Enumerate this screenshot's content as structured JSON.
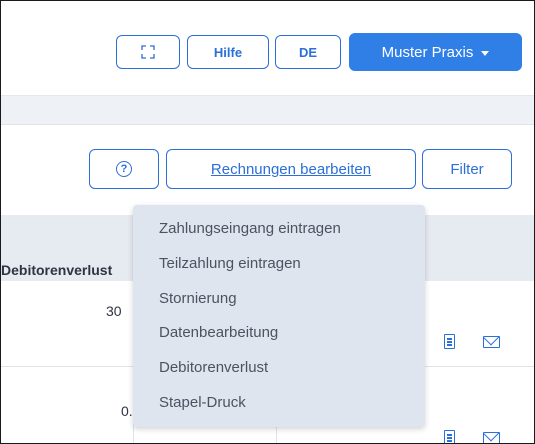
{
  "header": {
    "expand_icon": "expand-icon",
    "help_label": "Hilfe",
    "language_label": "DE",
    "practice_label": "Muster Praxis"
  },
  "toolbar": {
    "help_icon_glyph": "?",
    "edit_invoices_label": "Rechnungen bearbeiten",
    "filter_label": "Filter"
  },
  "table": {
    "column_header": "Debitorenverlust",
    "rows": [
      {
        "value": "30"
      },
      {
        "value": "0."
      }
    ]
  },
  "dropdown": {
    "items": [
      "Zahlungseingang eintragen",
      "Teilzahlung eintragen",
      "Stornierung",
      "Datenbearbeitung",
      "Debitorenverlust",
      "Stapel-Druck"
    ]
  },
  "colors": {
    "accent": "#2f7fe6",
    "dropdown_bg": "#dfe5ee"
  }
}
